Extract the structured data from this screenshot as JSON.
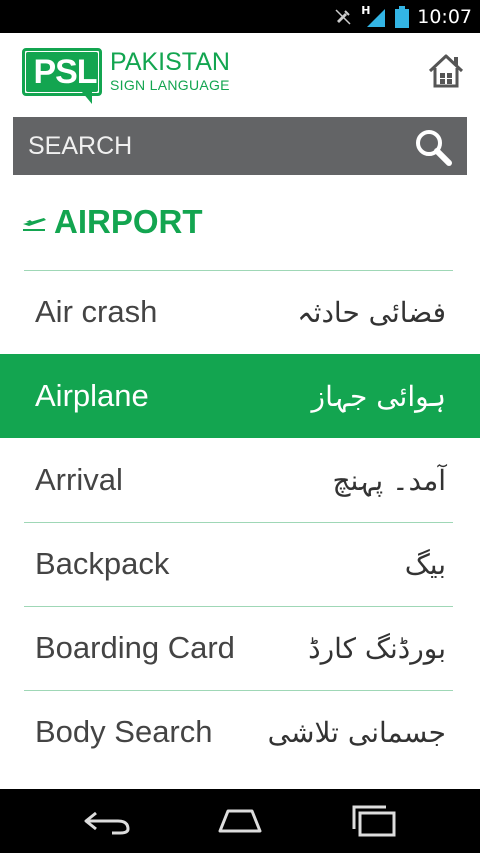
{
  "status_bar": {
    "time": "10:07",
    "network": "H"
  },
  "header": {
    "logo_letters": "PSL",
    "logo_line1": "PAKISTAN",
    "logo_line2": "SIGN LANGUAGE"
  },
  "search": {
    "placeholder": "SEARCH"
  },
  "category": {
    "title": "AIRPORT"
  },
  "items": [
    {
      "en": "Air crash",
      "ur": "فضائی حادثہ"
    },
    {
      "en": "Airplane",
      "ur": "ہوائی جہاز"
    },
    {
      "en": "Arrival",
      "ur": "آمد۔ پہنچ"
    },
    {
      "en": "Backpack",
      "ur": "بیگ"
    },
    {
      "en": "Boarding Card",
      "ur": "بورڈنگ کارڈ"
    },
    {
      "en": "Body Search",
      "ur": "جسمانی تلاشی"
    }
  ],
  "colors": {
    "brand_green": "#13a550",
    "search_bg": "#636466",
    "divider": "#9fd7b6"
  }
}
